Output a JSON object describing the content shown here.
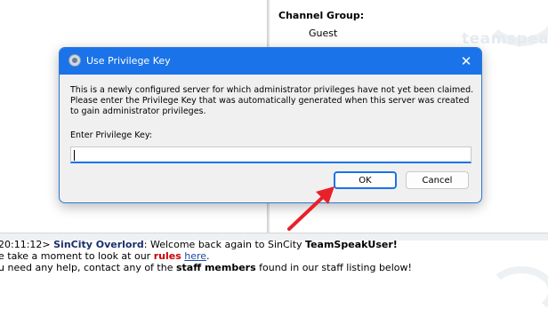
{
  "background": {
    "channel_group_label": "Channel Group:",
    "channel_group_value": "Guest",
    "logo_text": "teamspeak"
  },
  "chat": {
    "line1": {
      "time": "20:11:12>",
      "sender": "SinCity Overlord",
      "text": ": Welcome back again to SinCity ",
      "bold": "TeamSpeakUser!"
    },
    "line2": {
      "prefix": "e take a moment to look at our ",
      "red": "rules",
      "space": " ",
      "link": "here",
      "suffix": "."
    },
    "line3": {
      "prefix": "u need any help, contact any of the ",
      "bold": "staff members",
      "suffix": " found in our staff listing below!"
    }
  },
  "dialog": {
    "title": "Use Privilege Key",
    "close_glyph": "✕",
    "message_lines": [
      "This is a newly configured server for which administrator privileges have not yet been claimed.",
      "Please enter the Privilege Key that was automatically generated when this server was created",
      "to gain administrator privileges."
    ],
    "input_label": "Enter Privilege Key:",
    "input_value": "",
    "ok_label": "OK",
    "cancel_label": "Cancel"
  },
  "colors": {
    "accent": "#1a73e8",
    "annotation_arrow": "#e8202a"
  },
  "icons": {
    "app_icon": "teamspeak-icon",
    "close_icon": "close-icon",
    "annotation": "red-arrow"
  }
}
